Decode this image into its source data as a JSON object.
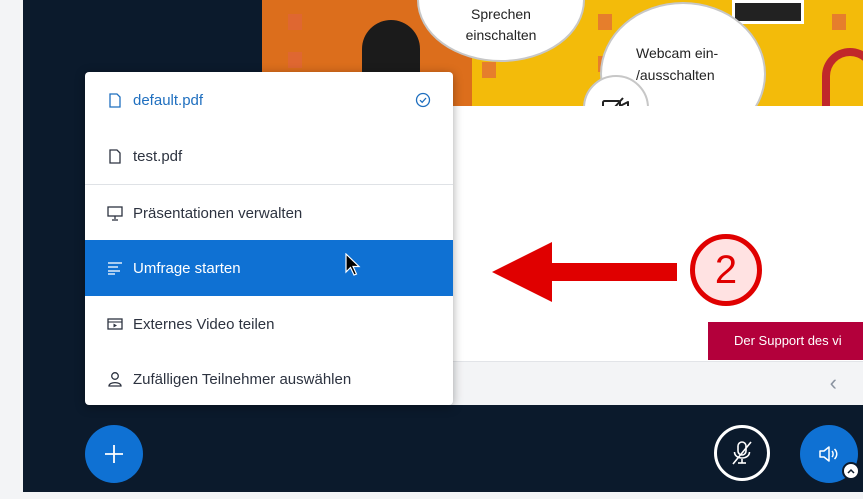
{
  "slide": {
    "bubble_speak": [
      "Sprechen",
      "einschalten"
    ],
    "bubble_webcam": [
      "Webcam ein-",
      "/ausschalten"
    ],
    "support_banner": "Der Support des vi",
    "prev_slide_icon": "chevron-left-icon"
  },
  "menu": {
    "items": [
      {
        "label": "default.pdf",
        "icon": "file-icon",
        "selected": true
      },
      {
        "label": "test.pdf",
        "icon": "file-icon"
      },
      {
        "label": "Präsentationen verwalten",
        "icon": "presentation-icon"
      },
      {
        "label": "Umfrage starten",
        "icon": "poll-icon",
        "hovered": true
      },
      {
        "label": "Externes Video teilen",
        "icon": "video-icon"
      },
      {
        "label": "Zufälligen Teilnehmer auswählen",
        "icon": "user-icon"
      }
    ]
  },
  "annotation": {
    "number": "2",
    "color": "#e00000"
  },
  "colors": {
    "accent": "#0f71d3",
    "dark_bg": "#0b1a2c",
    "banner": "#b3003b",
    "slide_yellow": "#f3bb0a"
  },
  "toolbar": {
    "actions_icon": "plus-icon",
    "mic_icon": "mic-muted-icon",
    "audio_icon": "speaker-icon"
  }
}
